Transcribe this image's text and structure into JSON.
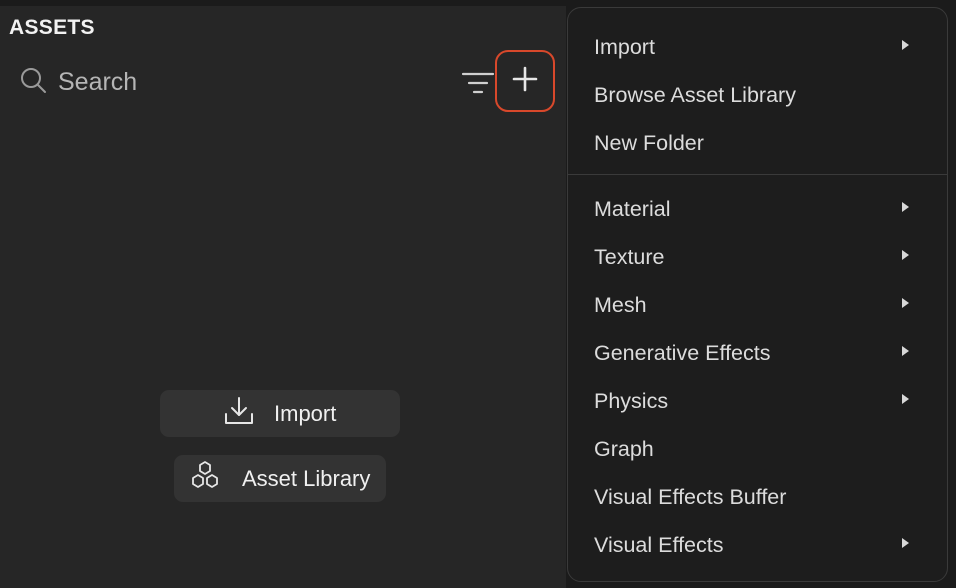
{
  "panel": {
    "title": "ASSETS",
    "search_placeholder": "Search",
    "empty_actions": {
      "import_label": "Import",
      "library_label": "Asset Library"
    },
    "icons": {
      "search": "search-icon",
      "filter": "filter-icon",
      "add": "plus-icon",
      "import": "download-icon",
      "library": "hexagons-icon"
    },
    "highlight_color": "#d8482b"
  },
  "menu": {
    "groups": [
      [
        {
          "label": "Import",
          "submenu": true
        },
        {
          "label": "Browse Asset Library",
          "submenu": false
        },
        {
          "label": "New Folder",
          "submenu": false
        }
      ],
      [
        {
          "label": "Material",
          "submenu": true
        },
        {
          "label": "Texture",
          "submenu": true
        },
        {
          "label": "Mesh",
          "submenu": true
        },
        {
          "label": "Generative Effects",
          "submenu": true
        },
        {
          "label": "Physics",
          "submenu": true
        },
        {
          "label": "Graph",
          "submenu": false
        },
        {
          "label": "Visual Effects Buffer",
          "submenu": false
        },
        {
          "label": "Visual Effects",
          "submenu": true
        }
      ]
    ]
  }
}
